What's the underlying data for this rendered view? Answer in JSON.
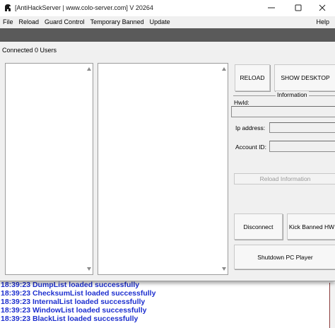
{
  "window": {
    "title": "[AntiHackServer | www.colo-server.com] V 20264",
    "icons": {
      "app": "spartan-helmet-icon",
      "minimize": "minimize-icon",
      "maximize": "maximize-icon",
      "close": "close-icon"
    }
  },
  "menu": {
    "items": [
      "File",
      "Reload",
      "Guard Control",
      "Temporary Banned",
      "Update"
    ],
    "help": "Help"
  },
  "dialog": {
    "status": "Connected 0 Users",
    "buttons": {
      "reload": "RELOAD",
      "show_desktop": "SHOW DESKTOP",
      "reload_information": "Reload Information",
      "disconnect": "Disconnect",
      "kick_banned_hw": "Kick Banned HW",
      "shutdown": "Shutdown PC Player"
    },
    "info": {
      "title": "Information",
      "hwid_label": "HwId:",
      "ip_label": "Ip address:",
      "account_label": "Account ID:",
      "hwid_value": "",
      "ip_value": "",
      "account_value": ""
    }
  },
  "log": [
    "18:39:23 DumpList loaded successfully",
    "18:39:23 ChecksumList loaded successfully",
    "18:39:23 InternalList loaded successfully",
    "18:39:23 WindowList loaded successfully",
    "18:39:23 BlackList loaded successfully"
  ],
  "colors": {
    "log_text": "#1d2fcf",
    "dialog_bg": "#f0f0f0",
    "band": "#5a5a5a"
  }
}
